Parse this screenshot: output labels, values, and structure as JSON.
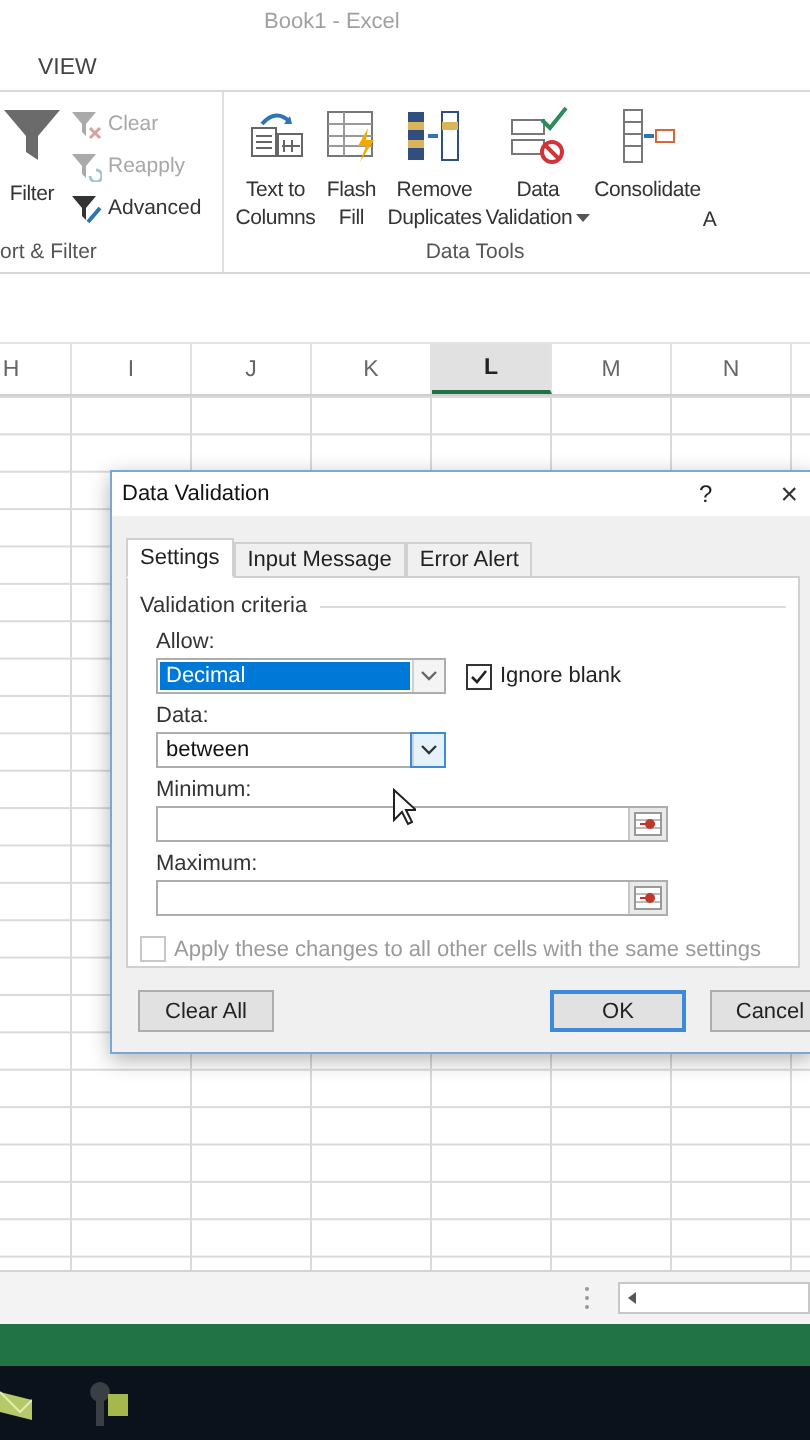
{
  "window": {
    "title": "Book1 - Excel"
  },
  "ribbon_tab": "VIEW",
  "sort_filter": {
    "big_button": "Filter",
    "small_buttons": [
      {
        "label": "Clear",
        "disabled": true
      },
      {
        "label": "Reapply",
        "disabled": true
      },
      {
        "label": "Advanced",
        "disabled": false
      }
    ],
    "group_label": "ort & Filter"
  },
  "data_tools": {
    "buttons": [
      {
        "lines": [
          "Text to",
          "Columns"
        ],
        "has_menu": false
      },
      {
        "lines": [
          "Flash",
          "Fill"
        ],
        "has_menu": false
      },
      {
        "lines": [
          "Remove",
          "Duplicates"
        ],
        "has_menu": false
      },
      {
        "lines": [
          "Data",
          "Validation"
        ],
        "has_menu": true
      },
      {
        "lines": [
          "Consolidate"
        ],
        "has_menu": false
      }
    ],
    "cut_label": "A",
    "group_label": "Data Tools"
  },
  "columns": [
    {
      "label": "H",
      "selected": false
    },
    {
      "label": "I",
      "selected": false
    },
    {
      "label": "J",
      "selected": false
    },
    {
      "label": "K",
      "selected": false
    },
    {
      "label": "L",
      "selected": true
    },
    {
      "label": "M",
      "selected": false
    },
    {
      "label": "N",
      "selected": false
    }
  ],
  "dialog": {
    "title": "Data Validation",
    "help": "?",
    "close": "×",
    "tabs": [
      {
        "label": "Settings",
        "selected": true
      },
      {
        "label": "Input Message",
        "selected": false
      },
      {
        "label": "Error Alert",
        "selected": false
      }
    ],
    "section": "Validation criteria",
    "allow": {
      "label": "Allow:",
      "value": "Decimal",
      "highlighted": true
    },
    "ignore_blank": {
      "label": "Ignore blank",
      "checked": true
    },
    "data": {
      "label": "Data:",
      "value": "between",
      "highlighted": false
    },
    "minimum": {
      "label": "Minimum:"
    },
    "maximum": {
      "label": "Maximum:"
    },
    "apply_all": {
      "label": "Apply these changes to all other cells with the same settings",
      "checked": false,
      "disabled": true
    },
    "buttons": [
      {
        "label": "Clear All",
        "default": false
      },
      {
        "label": "OK",
        "default": true
      },
      {
        "label": "Cancel",
        "default": false
      }
    ]
  }
}
